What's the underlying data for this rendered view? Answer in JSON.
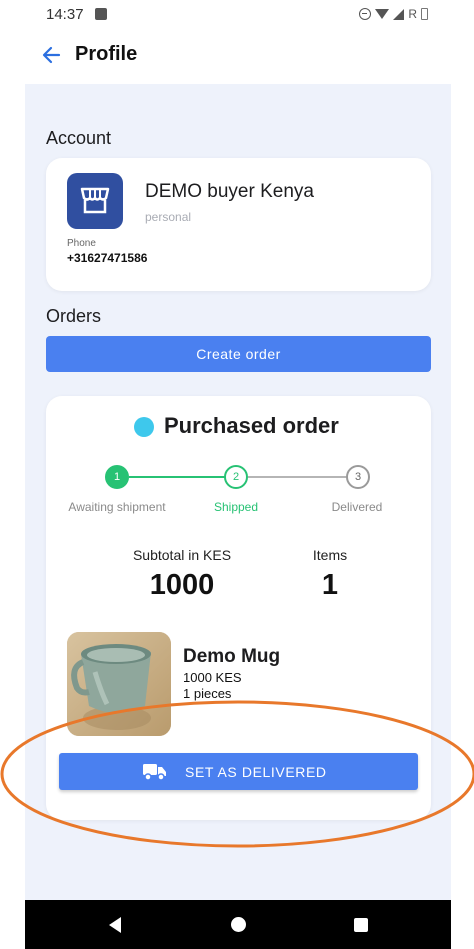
{
  "status_bar": {
    "time": "14:37",
    "network_label": "R"
  },
  "header": {
    "title": "Profile"
  },
  "account": {
    "section_label": "Account",
    "name": "DEMO buyer Kenya",
    "type": "personal",
    "phone_label": "Phone",
    "phone": "+31627471586"
  },
  "orders": {
    "section_label": "Orders",
    "create_button": "Create order"
  },
  "order": {
    "status_title": "Purchased order",
    "status_color": "#3ec8ec",
    "steps": [
      {
        "number": "1",
        "label": "Awaiting shipment",
        "state": "done"
      },
      {
        "number": "2",
        "label": "Shipped",
        "state": "active"
      },
      {
        "number": "3",
        "label": "Delivered",
        "state": "todo"
      }
    ],
    "subtotal_label": "Subtotal in KES",
    "subtotal_value": "1000",
    "items_label": "Items",
    "items_value": "1",
    "product": {
      "name": "Demo Mug",
      "price": "1000 KES",
      "quantity": "1 pieces"
    },
    "deliver_button": "SET AS DELIVERED"
  },
  "colors": {
    "primary": "#4a80f0",
    "success": "#27c274",
    "annotation": "#e8782b",
    "background": "#eef2fb"
  },
  "icons": [
    "back-arrow-icon",
    "store-icon",
    "truck-icon",
    "nav-back-icon",
    "nav-home-icon",
    "nav-recent-icon"
  ]
}
